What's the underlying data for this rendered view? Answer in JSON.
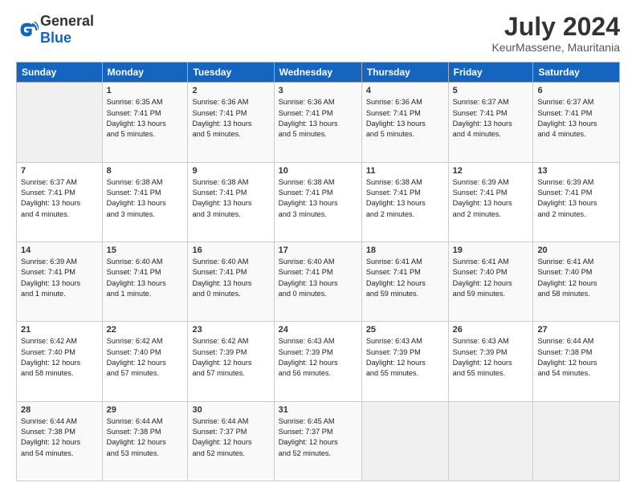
{
  "logo": {
    "text_general": "General",
    "text_blue": "Blue"
  },
  "header": {
    "month": "July 2024",
    "location": "KeurMassene, Mauritania"
  },
  "weekdays": [
    "Sunday",
    "Monday",
    "Tuesday",
    "Wednesday",
    "Thursday",
    "Friday",
    "Saturday"
  ],
  "weeks": [
    [
      {
        "day": "",
        "info": ""
      },
      {
        "day": "1",
        "info": "Sunrise: 6:35 AM\nSunset: 7:41 PM\nDaylight: 13 hours\nand 5 minutes."
      },
      {
        "day": "2",
        "info": "Sunrise: 6:36 AM\nSunset: 7:41 PM\nDaylight: 13 hours\nand 5 minutes."
      },
      {
        "day": "3",
        "info": "Sunrise: 6:36 AM\nSunset: 7:41 PM\nDaylight: 13 hours\nand 5 minutes."
      },
      {
        "day": "4",
        "info": "Sunrise: 6:36 AM\nSunset: 7:41 PM\nDaylight: 13 hours\nand 5 minutes."
      },
      {
        "day": "5",
        "info": "Sunrise: 6:37 AM\nSunset: 7:41 PM\nDaylight: 13 hours\nand 4 minutes."
      },
      {
        "day": "6",
        "info": "Sunrise: 6:37 AM\nSunset: 7:41 PM\nDaylight: 13 hours\nand 4 minutes."
      }
    ],
    [
      {
        "day": "7",
        "info": "Sunrise: 6:37 AM\nSunset: 7:41 PM\nDaylight: 13 hours\nand 4 minutes."
      },
      {
        "day": "8",
        "info": "Sunrise: 6:38 AM\nSunset: 7:41 PM\nDaylight: 13 hours\nand 3 minutes."
      },
      {
        "day": "9",
        "info": "Sunrise: 6:38 AM\nSunset: 7:41 PM\nDaylight: 13 hours\nand 3 minutes."
      },
      {
        "day": "10",
        "info": "Sunrise: 6:38 AM\nSunset: 7:41 PM\nDaylight: 13 hours\nand 3 minutes."
      },
      {
        "day": "11",
        "info": "Sunrise: 6:38 AM\nSunset: 7:41 PM\nDaylight: 13 hours\nand 2 minutes."
      },
      {
        "day": "12",
        "info": "Sunrise: 6:39 AM\nSunset: 7:41 PM\nDaylight: 13 hours\nand 2 minutes."
      },
      {
        "day": "13",
        "info": "Sunrise: 6:39 AM\nSunset: 7:41 PM\nDaylight: 13 hours\nand 2 minutes."
      }
    ],
    [
      {
        "day": "14",
        "info": "Sunrise: 6:39 AM\nSunset: 7:41 PM\nDaylight: 13 hours\nand 1 minute."
      },
      {
        "day": "15",
        "info": "Sunrise: 6:40 AM\nSunset: 7:41 PM\nDaylight: 13 hours\nand 1 minute."
      },
      {
        "day": "16",
        "info": "Sunrise: 6:40 AM\nSunset: 7:41 PM\nDaylight: 13 hours\nand 0 minutes."
      },
      {
        "day": "17",
        "info": "Sunrise: 6:40 AM\nSunset: 7:41 PM\nDaylight: 13 hours\nand 0 minutes."
      },
      {
        "day": "18",
        "info": "Sunrise: 6:41 AM\nSunset: 7:41 PM\nDaylight: 12 hours\nand 59 minutes."
      },
      {
        "day": "19",
        "info": "Sunrise: 6:41 AM\nSunset: 7:40 PM\nDaylight: 12 hours\nand 59 minutes."
      },
      {
        "day": "20",
        "info": "Sunrise: 6:41 AM\nSunset: 7:40 PM\nDaylight: 12 hours\nand 58 minutes."
      }
    ],
    [
      {
        "day": "21",
        "info": "Sunrise: 6:42 AM\nSunset: 7:40 PM\nDaylight: 12 hours\nand 58 minutes."
      },
      {
        "day": "22",
        "info": "Sunrise: 6:42 AM\nSunset: 7:40 PM\nDaylight: 12 hours\nand 57 minutes."
      },
      {
        "day": "23",
        "info": "Sunrise: 6:42 AM\nSunset: 7:39 PM\nDaylight: 12 hours\nand 57 minutes."
      },
      {
        "day": "24",
        "info": "Sunrise: 6:43 AM\nSunset: 7:39 PM\nDaylight: 12 hours\nand 56 minutes."
      },
      {
        "day": "25",
        "info": "Sunrise: 6:43 AM\nSunset: 7:39 PM\nDaylight: 12 hours\nand 55 minutes."
      },
      {
        "day": "26",
        "info": "Sunrise: 6:43 AM\nSunset: 7:39 PM\nDaylight: 12 hours\nand 55 minutes."
      },
      {
        "day": "27",
        "info": "Sunrise: 6:44 AM\nSunset: 7:38 PM\nDaylight: 12 hours\nand 54 minutes."
      }
    ],
    [
      {
        "day": "28",
        "info": "Sunrise: 6:44 AM\nSunset: 7:38 PM\nDaylight: 12 hours\nand 54 minutes."
      },
      {
        "day": "29",
        "info": "Sunrise: 6:44 AM\nSunset: 7:38 PM\nDaylight: 12 hours\nand 53 minutes."
      },
      {
        "day": "30",
        "info": "Sunrise: 6:44 AM\nSunset: 7:37 PM\nDaylight: 12 hours\nand 52 minutes."
      },
      {
        "day": "31",
        "info": "Sunrise: 6:45 AM\nSunset: 7:37 PM\nDaylight: 12 hours\nand 52 minutes."
      },
      {
        "day": "",
        "info": ""
      },
      {
        "day": "",
        "info": ""
      },
      {
        "day": "",
        "info": ""
      }
    ]
  ]
}
